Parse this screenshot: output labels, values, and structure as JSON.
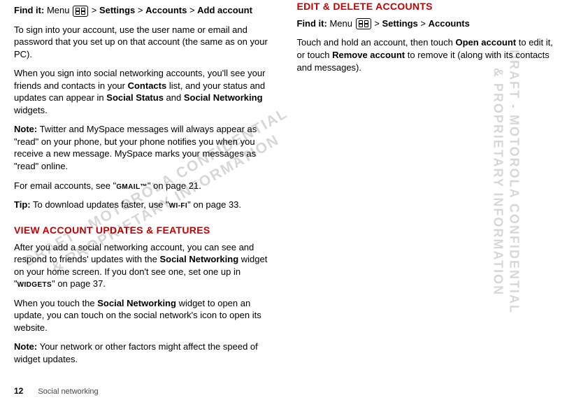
{
  "left": {
    "findit_label": "Find it:",
    "menu_label": "Menu",
    "path_parts": [
      "Settings",
      "Accounts",
      "Add account"
    ],
    "gt": ">",
    "p1": "To sign into your account, use the user name or email and password that you set up on that account (the same as on your PC).",
    "p2a": "When you sign into social networking accounts, you'll see your friends and contacts in your ",
    "p2b": "Contacts",
    "p2c": " list, and your status and updates can appear in ",
    "p2d": "Social Status",
    "p2e": " and ",
    "p2f": "Social Networking",
    "p2g": " widgets.",
    "note1_label": "Note:",
    "note1_text": " Twitter and MySpace messages will always appear as \"read\" on your phone, but your phone notifies you when you receive a new message. MySpace marks your messages as \"read\" online.",
    "email_a": "For email accounts, see \"",
    "email_b": "GMAIL™",
    "email_c": "\" on page 21.",
    "tip_label": "Tip:",
    "tip_a": " To download updates faster, use \"",
    "tip_b": "WI-FI",
    "tip_c": "\" on page 33.",
    "heading_view": "VIEW ACCOUNT UPDATES & FEATURES",
    "pv1a": "After you add a social networking account, you can see and respond to friends' updates with the ",
    "pv1b": "Social Networking",
    "pv1c": " widget on your home screen. If you don't see one, set one up in \"",
    "pv1d": "WIDGETS",
    "pv1e": "\" on page 37.",
    "pv2a": "When you touch the ",
    "pv2b": "Social Networking",
    "pv2c": " widget to open an update, you can touch on the social network's icon to open its website.",
    "note2_label": "Note:",
    "note2_text": " Your network or other factors might affect the speed of widget updates."
  },
  "right": {
    "heading_edit": "EDIT & DELETE ACCOUNTS",
    "findit_label": "Find it:",
    "menu_label": "Menu",
    "path_parts": [
      "Settings",
      "Accounts"
    ],
    "gt": ">",
    "p1a": "Touch and hold an account, then touch ",
    "p1b": "Open account",
    "p1c": " to edit it, or touch ",
    "p1d": "Remove account",
    "p1e": " to remove it (along with its contacts and messages)."
  },
  "footer": {
    "page": "12",
    "section": "Social networking"
  },
  "watermark1": "DRAFT - MOTOROLA CONFIDENTIAL\n& PROPRIETARY INFORMATION",
  "watermark2": "DRAFT - MOTOROLA CONFIDENTIAL\n& PROPRIETARY INFORMATION"
}
